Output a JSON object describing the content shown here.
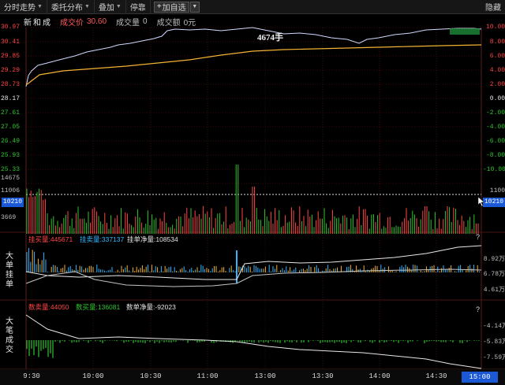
{
  "toolbar": {
    "items": [
      "分时走势",
      "委托分布",
      "叠加",
      "停靠"
    ],
    "add_watchlist": "加自选",
    "hide": "隐藏"
  },
  "infobar": {
    "stock_name": "新和成",
    "price_label": "成交价",
    "price_value": "30.60",
    "volume_label": "成交量",
    "volume_value": "0",
    "amount_label": "成交额",
    "amount_value": "0元"
  },
  "price_axis": {
    "left": [
      "30.97",
      "30.41",
      "29.85",
      "29.29",
      "28.73",
      "28.17",
      "27.61",
      "27.05",
      "26.49",
      "25.93",
      "25.33"
    ],
    "right": [
      "10.00",
      "8.00",
      "6.00",
      "4.00",
      "2.00",
      "0.00",
      "-2.00",
      "-4.00",
      "-6.00",
      "-8.00",
      "-10.00"
    ]
  },
  "volume_axis": {
    "left": [
      "14675",
      "11006",
      "10210",
      "3669"
    ],
    "right": [
      "1100",
      "10210"
    ],
    "annotation": "4674手"
  },
  "panel_big_order": {
    "title": "大单挂单",
    "legend": {
      "buy_label": "挂买量:445671",
      "sell_label": "挂卖量:337137",
      "net_label": "挂单净量:108534"
    },
    "right_axis": [
      "8.92万",
      "6.78万",
      "4.61万"
    ],
    "help": "?"
  },
  "panel_big_trade": {
    "title": "大笔成交",
    "legend": {
      "sell_label": "数卖量:44050",
      "buy_label": "数买量:136081",
      "net_label": "数单净量:-92023"
    },
    "right_axis": [
      "-4.14万",
      "-5.83万",
      "-7.59万"
    ],
    "help": "?"
  },
  "time_axis": {
    "ticks": [
      "9:30",
      "10:00",
      "10:30",
      "11:00",
      "13:00",
      "13:30",
      "14:00",
      "14:30"
    ],
    "current": "15:00"
  },
  "colors": {
    "up": "#ff4646",
    "down": "#2fc42f",
    "price_line": "#d0d8ff",
    "avg_line": "#f2b233",
    "accent": "#1a58d6"
  }
}
